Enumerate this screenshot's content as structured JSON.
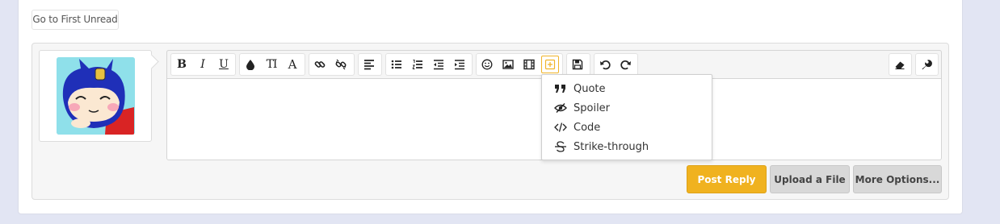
{
  "nav": {
    "first_unread_label": "Go to First Unread"
  },
  "toolbar": {
    "bold_glyph": "B",
    "italic_glyph": "I",
    "underline_glyph": "U",
    "font_size_glyph": "TI",
    "font_family_glyph": "A"
  },
  "insert_menu": {
    "items": [
      {
        "label": "Quote",
        "icon": "quote-icon"
      },
      {
        "label": "Spoiler",
        "icon": "eye-slash-icon"
      },
      {
        "label": "Code",
        "icon": "code-icon"
      },
      {
        "label": "Strike-through",
        "icon": "strikethrough-icon"
      }
    ]
  },
  "actions": {
    "post_reply": "Post Reply",
    "upload_file": "Upload a File",
    "more_options": "More Options..."
  },
  "colors": {
    "accent": "#f0b21f",
    "page_bg": "#e2e5f3",
    "avatar_bg": "#8fe0ea"
  }
}
